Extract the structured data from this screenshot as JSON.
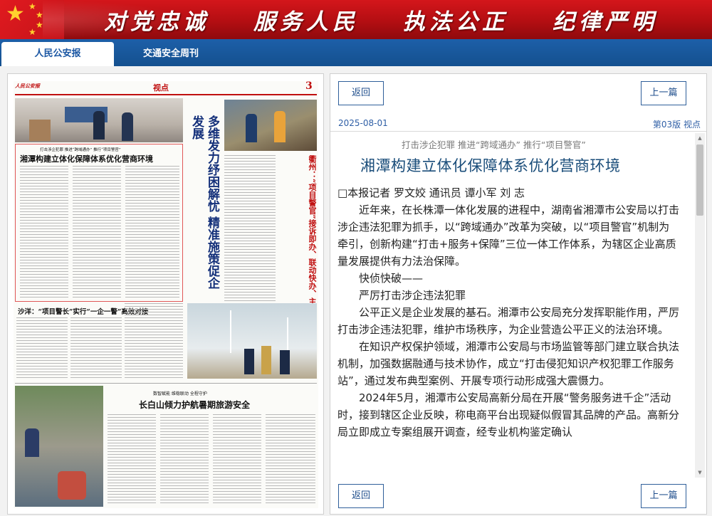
{
  "banner": {
    "slogans": [
      "对党忠诚",
      "服务人民",
      "执法公正",
      "纪律严明"
    ]
  },
  "tabs": [
    {
      "label": "人民公安报",
      "active": true
    },
    {
      "label": "交通安全周刊",
      "active": false
    }
  ],
  "newspaper": {
    "masthead": "人民公安报",
    "page_number": "3",
    "page_section": "视点",
    "main_kicker": "打击涉企犯罪  推进“跨域通办”  推行“项目警官”",
    "main_headline": "湘潭构建立体化保障体系优化营商环境",
    "vertical_headline": "多维发力纾困解忧  精准施策促企发展",
    "side_headline": "衢州：“项目警官”接诉即办、联动快办、主动帮办",
    "lower_headline": "沙洋：“项目警长”实行“一企一警”高效对接",
    "bottom_kicker": "数智赋能  维稳联动  全程守护",
    "bottom_headline": "长白山倾力护航暑期旅游安全"
  },
  "article": {
    "back_label": "返回",
    "prev_label": "上一篇",
    "date": "2025-08-01",
    "edition": "第03版 视点",
    "kicker": "打击涉企犯罪 推进“跨域通办” 推行“项目警官”",
    "title": "湘潭构建立体化保障体系优化营商环境",
    "byline": "□本报记者 罗文姣 通讯员 谭小军 刘 志",
    "paragraphs": [
      "近年来，在长株潭一体化发展的进程中，湖南省湘潭市公安局以打击涉企违法犯罪为抓手，以“跨域通办”改革为突破，以“项目警官”机制为牵引，创新构建“打击+服务+保障”三位一体工作体系，为辖区企业高质量发展提供有力法治保障。",
      "快侦快破——",
      "严厉打击涉企违法犯罪",
      "公平正义是企业发展的基石。湘潭市公安局充分发挥职能作用，严厉打击涉企违法犯罪，维护市场秩序，为企业营造公平正义的法治环境。",
      "在知识产权保护领域，湘潭市公安局与市场监管等部门建立联合执法机制，加强数据融通与技术协作，成立“打击侵犯知识产权犯罪工作服务站”，通过发布典型案例、开展专项行动形成强大震慑力。",
      "2024年5月，湘潭市公安局高新分局在开展“警务服务进千企”活动时，接到辖区企业反映，称电商平台出现疑似假冒其品牌的产品。高新分局立即成立专案组展开调查，经专业机构鉴定确认"
    ]
  }
}
